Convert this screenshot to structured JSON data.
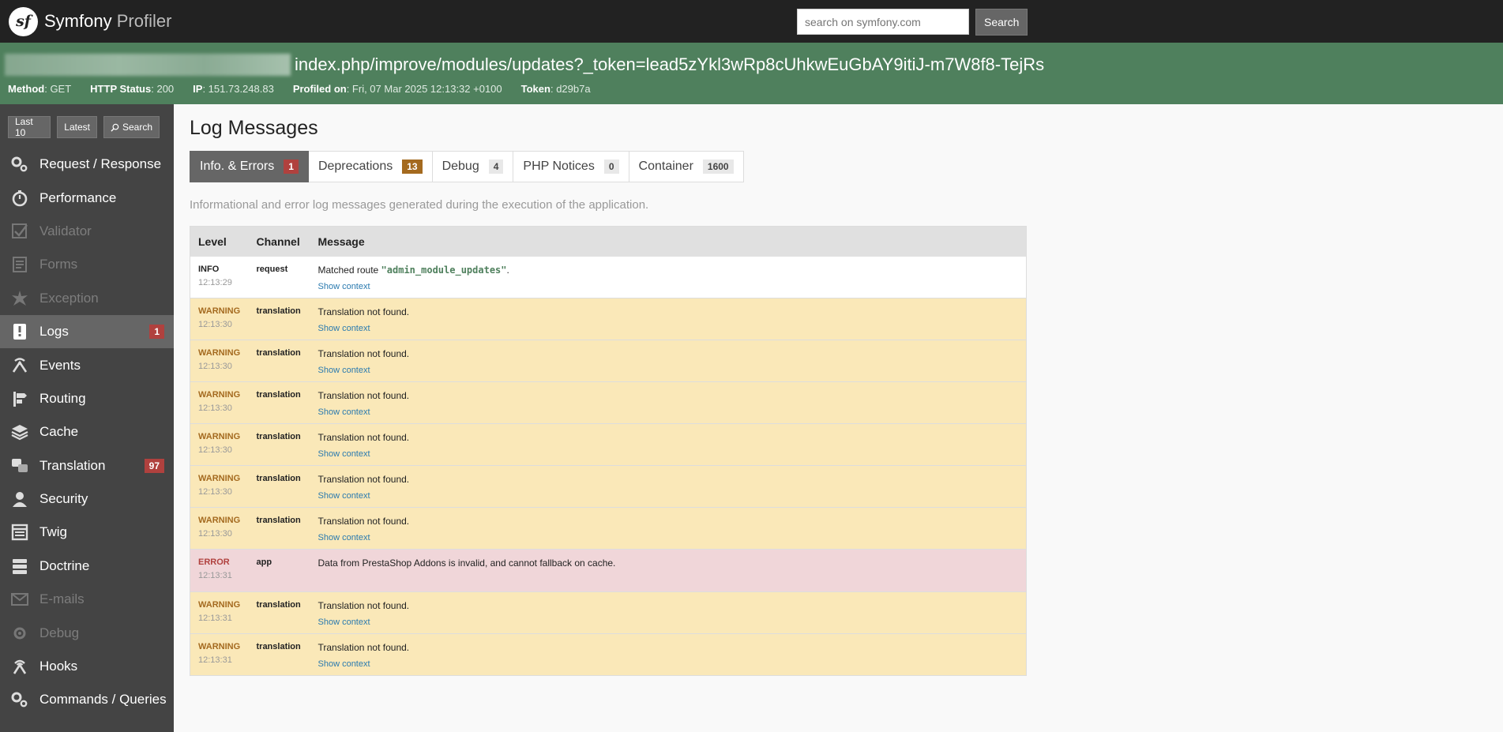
{
  "header": {
    "logo_symbol": "sf",
    "brand_main": "Symfony",
    "brand_light": "Profiler",
    "search_placeholder": "search on symfony.com",
    "search_button": "Search"
  },
  "summary": {
    "url": "index.php/improve/modules/updates?_token=lead5zYkl3wRp8cUhkwEuGbAY9itiJ-m7W8f8-TejRs",
    "method_label": "Method",
    "method": ": GET",
    "status_label": "HTTP Status",
    "status": ": 200",
    "ip_label": "IP",
    "ip": ": 151.73.248.83",
    "profiled_label": "Profiled on",
    "profiled": ": Fri, 07 Mar 2025 12:13:32 +0100",
    "token_label": "Token",
    "token": ": d29b7a"
  },
  "sidebar": {
    "buttons": [
      "Last 10",
      "Latest",
      "Search"
    ],
    "items": [
      {
        "label": "Request / Response",
        "icon": "gears-icon"
      },
      {
        "label": "Performance",
        "icon": "stopwatch-icon"
      },
      {
        "label": "Validator",
        "icon": "check-icon"
      },
      {
        "label": "Forms",
        "icon": "form-icon"
      },
      {
        "label": "Exception",
        "icon": "explosion-icon"
      },
      {
        "label": "Logs",
        "icon": "log-icon",
        "badge": "1"
      },
      {
        "label": "Events",
        "icon": "broadcast-icon"
      },
      {
        "label": "Routing",
        "icon": "signpost-icon"
      },
      {
        "label": "Cache",
        "icon": "layers-icon"
      },
      {
        "label": "Translation",
        "icon": "translate-icon",
        "badge": "97"
      },
      {
        "label": "Security",
        "icon": "user-icon"
      },
      {
        "label": "Twig",
        "icon": "template-icon"
      },
      {
        "label": "Doctrine",
        "icon": "database-icon"
      },
      {
        "label": "E-mails",
        "icon": "envelope-icon"
      },
      {
        "label": "Debug",
        "icon": "bug-gear-icon"
      },
      {
        "label": "Hooks",
        "icon": "antenna-icon"
      },
      {
        "label": "Commands / Queries",
        "icon": "gears-icon"
      }
    ]
  },
  "main": {
    "title": "Log Messages",
    "tabs": [
      {
        "label": "Info. & Errors",
        "count": "1"
      },
      {
        "label": "Deprecations",
        "count": "13"
      },
      {
        "label": "Debug",
        "count": "4"
      },
      {
        "label": "PHP Notices",
        "count": "0"
      },
      {
        "label": "Container",
        "count": "1600"
      }
    ],
    "description": "Informational and error log messages generated during the execution of the application.",
    "columns": [
      "Level",
      "Channel",
      "Message"
    ],
    "show_context": "Show context",
    "rows": [
      {
        "level": "INFO",
        "time": "12:13:29",
        "channel": "request",
        "msg_pre": "Matched route ",
        "msg_route": "\"admin_module_updates\"",
        "msg_post": ".",
        "type": "info"
      },
      {
        "level": "WARNING",
        "time": "12:13:30",
        "channel": "translation",
        "msg_pre": "Translation not found.",
        "type": "warn"
      },
      {
        "level": "WARNING",
        "time": "12:13:30",
        "channel": "translation",
        "msg_pre": "Translation not found.",
        "type": "warn"
      },
      {
        "level": "WARNING",
        "time": "12:13:30",
        "channel": "translation",
        "msg_pre": "Translation not found.",
        "type": "warn"
      },
      {
        "level": "WARNING",
        "time": "12:13:30",
        "channel": "translation",
        "msg_pre": "Translation not found.",
        "type": "warn"
      },
      {
        "level": "WARNING",
        "time": "12:13:30",
        "channel": "translation",
        "msg_pre": "Translation not found.",
        "type": "warn"
      },
      {
        "level": "WARNING",
        "time": "12:13:30",
        "channel": "translation",
        "msg_pre": "Translation not found.",
        "type": "warn"
      },
      {
        "level": "ERROR",
        "time": "12:13:31",
        "channel": "app",
        "msg_pre": "Data from PrestaShop Addons is invalid, and cannot fallback on cache.",
        "type": "error"
      },
      {
        "level": "WARNING",
        "time": "12:13:31",
        "channel": "translation",
        "msg_pre": "Translation not found.",
        "type": "warn"
      },
      {
        "level": "WARNING",
        "time": "12:13:31",
        "channel": "translation",
        "msg_pre": "Translation not found.",
        "type": "warn"
      }
    ]
  }
}
